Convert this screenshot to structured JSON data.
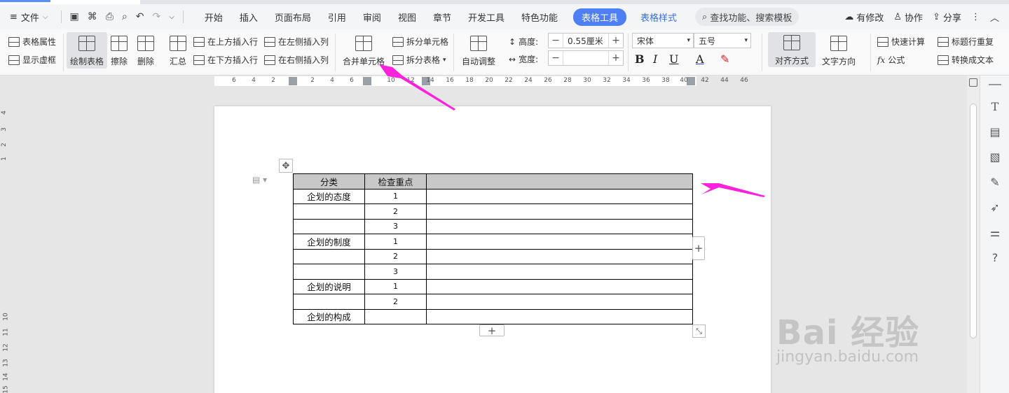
{
  "menubar": {
    "file_label": "文件",
    "tabs": [
      "开始",
      "插入",
      "页面布局",
      "引用",
      "审阅",
      "视图",
      "章节",
      "开发工具",
      "特色功能"
    ],
    "special_tab": "表格工具",
    "blue_tab": "表格样式",
    "search_label": "查找功能、搜索模板",
    "right": {
      "modified": "有修改",
      "collab": "协作",
      "share": "分享"
    }
  },
  "ribbon": {
    "table_props": "表格属性",
    "show_gridlines": "显示虚框",
    "draw_table": "绘制表格",
    "erase": "擦除",
    "delete": "删除",
    "summary": "汇总",
    "insert_above": "在上方插入行",
    "insert_below": "在下方插入行",
    "insert_left": "在左侧插入列",
    "insert_right": "在右侧插入列",
    "merge_cells": "合并单元格",
    "split_cells": "拆分单元格",
    "split_table": "拆分表格",
    "auto_adjust": "自动调整",
    "height_label": "高度:",
    "height_value": "0.55厘米",
    "width_label": "宽度:",
    "width_value": "",
    "font_name": "宋体",
    "font_size": "五号",
    "align": "对齐方式",
    "text_direction": "文字方向",
    "quick_calc": "快速计算",
    "formula": "公式",
    "repeat_header": "标题行重复",
    "convert_text": "转换成文本"
  },
  "ruler_ticks": [
    "6",
    "4",
    "2",
    "2",
    "4",
    "6",
    "10",
    "12",
    "14",
    "16",
    "18",
    "20",
    "22",
    "24",
    "26",
    "28",
    "30",
    "32",
    "34",
    "36",
    "38",
    "40",
    "42",
    "44",
    "46"
  ],
  "vruler_ticks": [
    "4",
    "3",
    "2",
    "1",
    "10",
    "11",
    "12",
    "13",
    "14",
    "15"
  ],
  "table": {
    "header": [
      "分类",
      "检查重点",
      ""
    ],
    "rows": [
      [
        "企划的态度",
        "1",
        ""
      ],
      [
        "",
        "2",
        ""
      ],
      [
        "",
        "3",
        ""
      ],
      [
        "企划的制度",
        "1",
        ""
      ],
      [
        "",
        "2",
        ""
      ],
      [
        "",
        "3",
        ""
      ],
      [
        "企划的说明",
        "1",
        ""
      ],
      [
        "",
        "2",
        ""
      ],
      [
        "企划的构成",
        "",
        ""
      ]
    ]
  },
  "watermark": {
    "brand": "Bai  经验",
    "url": "jingyan.baidu.com"
  },
  "colors": {
    "accent": "#4e7ff5",
    "arrow": "#ff22dd",
    "selection": "#c8c8c8"
  },
  "icons": [
    "menu-icon",
    "save-icon",
    "print-icon",
    "undo-icon",
    "redo-icon",
    "search-icon",
    "cloud-icon",
    "user-icon",
    "share-icon",
    "more-icon",
    "collapse-icon"
  ]
}
